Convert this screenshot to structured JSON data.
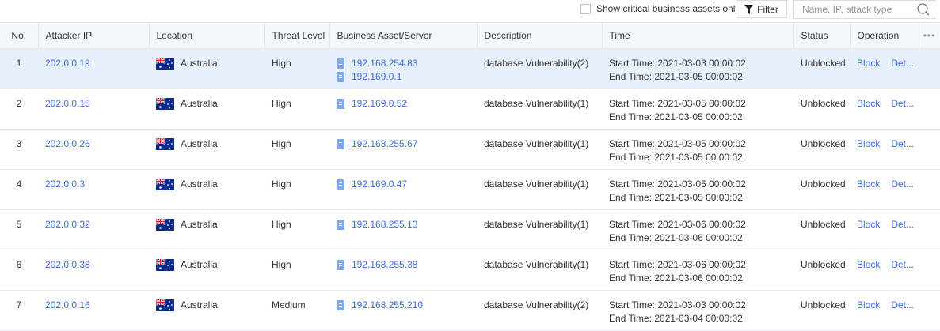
{
  "toolbar": {
    "checkbox_label": "Show critical business assets only",
    "filter_label": "Filter",
    "search_placeholder": "Name, IP, attack type"
  },
  "columns": {
    "no": "No.",
    "attacker_ip": "Attacker IP",
    "location": "Location",
    "threat": "Threat Level",
    "asset": "Business Asset/Server",
    "description": "Description",
    "time": "Time",
    "status": "Status",
    "operation": "Operation"
  },
  "labels": {
    "start": "Start Time: ",
    "end": "End Time: ",
    "block": "Block",
    "details": "Det..."
  },
  "colors": {
    "link": "#3c6cf0",
    "selected_row": "#e8effd",
    "header_bg": "#f5f7fa"
  },
  "rows": [
    {
      "no": "1",
      "ip": "202.0.0.19",
      "location": "Australia",
      "threat": "High",
      "assets": [
        "192.168.254.83",
        "192.169.0.1"
      ],
      "description": "database Vulnerability(2)",
      "start": "2021-03-03 00:00:02",
      "end": "2021-03-05 00:00:02",
      "status": "Unblocked",
      "selected": true
    },
    {
      "no": "2",
      "ip": "202.0.0.15",
      "location": "Australia",
      "threat": "High",
      "assets": [
        "192.169.0.52"
      ],
      "description": "database Vulnerability(1)",
      "start": "2021-03-05 00:00:02",
      "end": "2021-03-05 00:00:02",
      "status": "Unblocked"
    },
    {
      "no": "3",
      "ip": "202.0.0.26",
      "location": "Australia",
      "threat": "High",
      "assets": [
        "192.168.255.67"
      ],
      "description": "database Vulnerability(1)",
      "start": "2021-03-05 00:00:02",
      "end": "2021-03-05 00:00:02",
      "status": "Unblocked"
    },
    {
      "no": "4",
      "ip": "202.0.0.3",
      "location": "Australia",
      "threat": "High",
      "assets": [
        "192.169.0.47"
      ],
      "description": "database Vulnerability(1)",
      "start": "2021-03-05 00:00:02",
      "end": "2021-03-05 00:00:02",
      "status": "Unblocked"
    },
    {
      "no": "5",
      "ip": "202.0.0.32",
      "location": "Australia",
      "threat": "High",
      "assets": [
        "192.168.255.13"
      ],
      "description": "database Vulnerability(1)",
      "start": "2021-03-06 00:00:02",
      "end": "2021-03-06 00:00:02",
      "status": "Unblocked"
    },
    {
      "no": "6",
      "ip": "202.0.0.38",
      "location": "Australia",
      "threat": "High",
      "assets": [
        "192.168.255.38"
      ],
      "description": "database Vulnerability(1)",
      "start": "2021-03-06 00:00:02",
      "end": "2021-03-06 00:00:02",
      "status": "Unblocked"
    },
    {
      "no": "7",
      "ip": "202.0.0.16",
      "location": "Australia",
      "threat": "Medium",
      "assets": [
        "192.168.255.210"
      ],
      "description": "database Vulnerability(2)",
      "start": "2021-03-03 00:00:02",
      "end": "2021-03-04 00:00:02",
      "status": "Unblocked"
    }
  ]
}
